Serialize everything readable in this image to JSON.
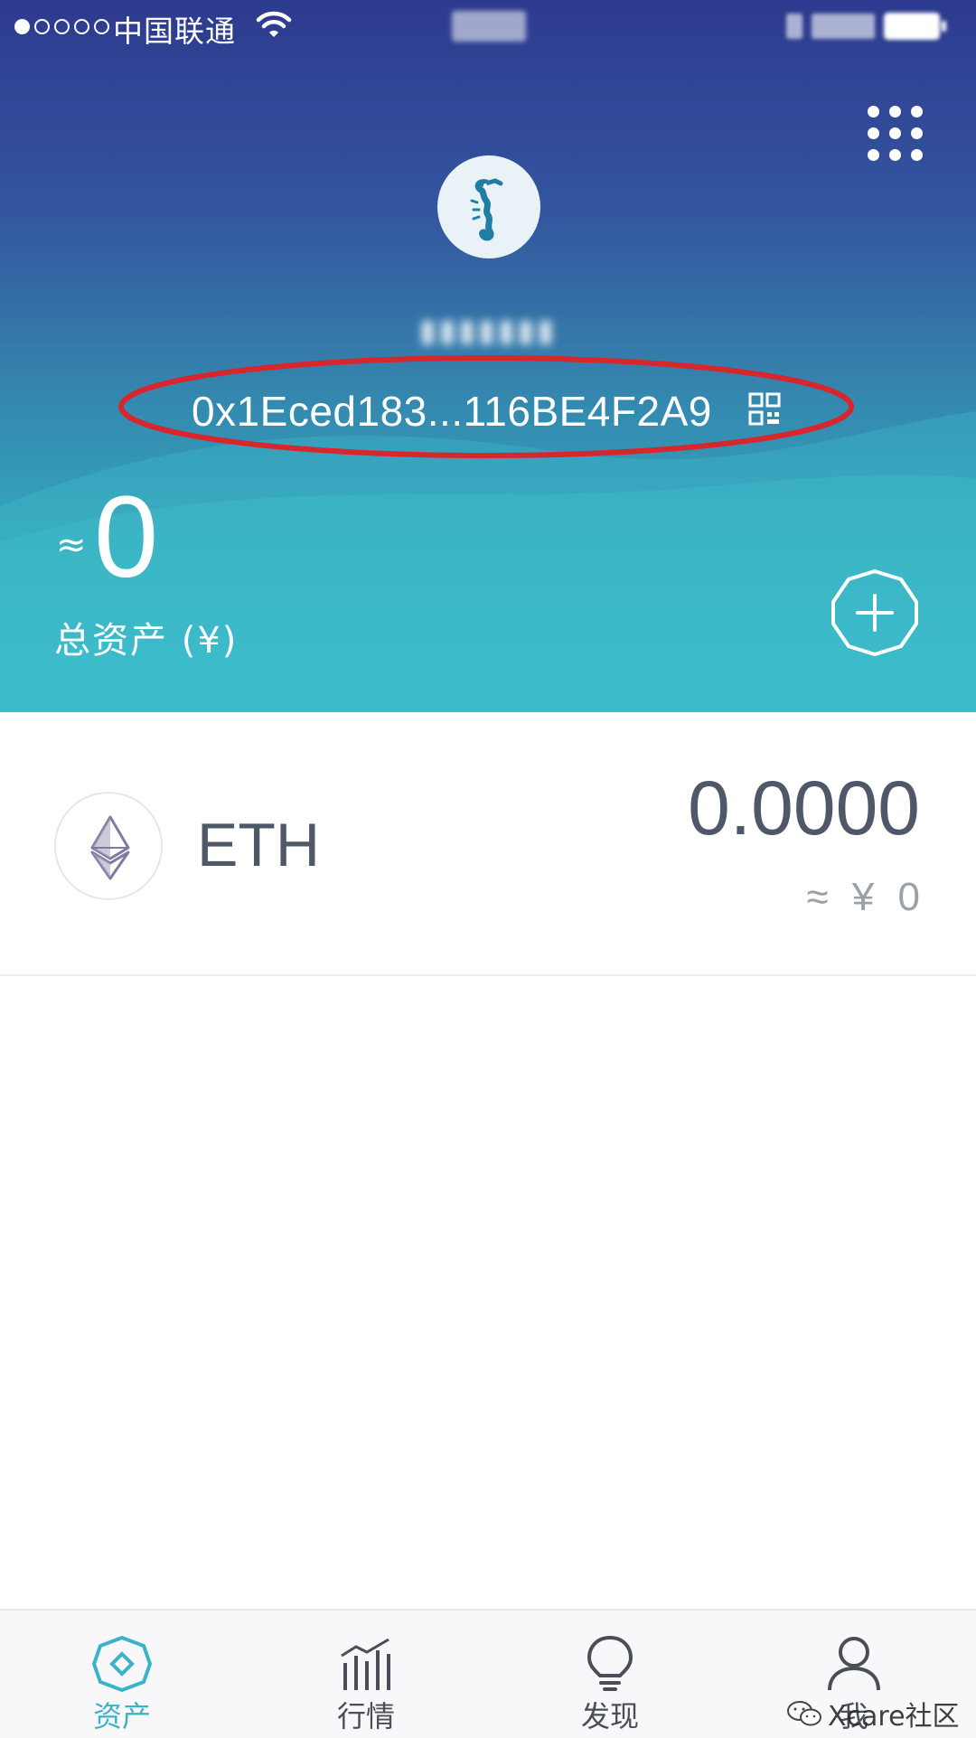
{
  "status_bar": {
    "carrier": "中国联通",
    "time": "",
    "signal_bars_filled": 1,
    "signal_bars_total": 5
  },
  "header": {
    "wallet_name": "",
    "address": "0x1Eced183...116BE4F2A9",
    "approx_symbol": "≈",
    "total_value": "0",
    "total_label": "总资产 (¥)"
  },
  "assets": [
    {
      "symbol": "ETH",
      "balance": "0.0000",
      "fiat_value": "≈ ¥ 0",
      "icon": "ethereum-icon"
    }
  ],
  "tabs": [
    {
      "label": "资产",
      "icon": "assets-diamond-icon",
      "active": true
    },
    {
      "label": "行情",
      "icon": "market-chart-icon",
      "active": false
    },
    {
      "label": "发现",
      "icon": "lightbulb-icon",
      "active": false
    },
    {
      "label": "我",
      "icon": "person-icon",
      "active": false
    }
  ],
  "watermark": "Xcare社区",
  "colors": {
    "header_top": "#2d3a8f",
    "header_bottom": "#38bacb",
    "accent": "#3ab3c7",
    "highlight": "#d9262c",
    "text_dark": "#4f5868"
  }
}
